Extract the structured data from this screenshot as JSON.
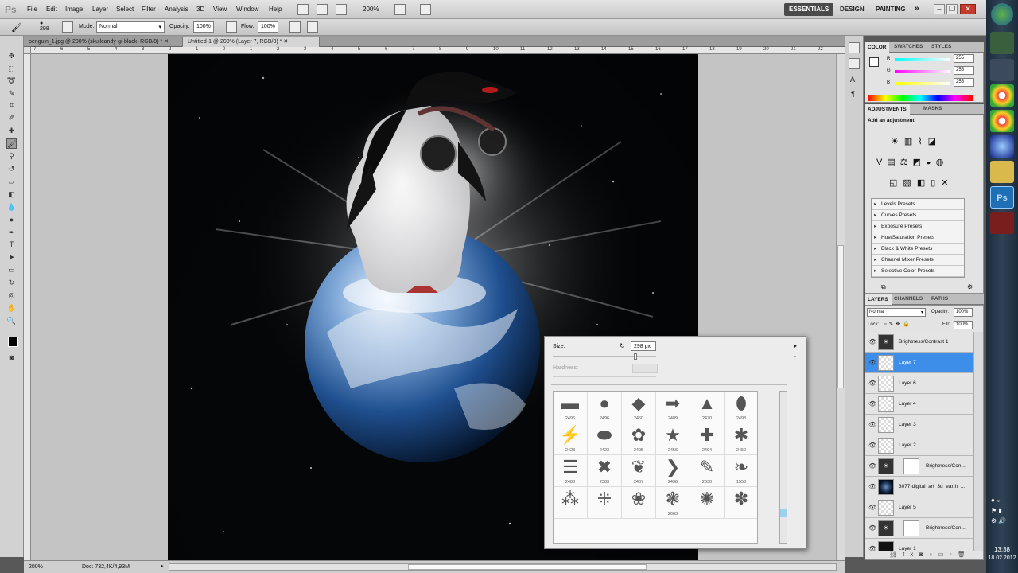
{
  "app": {
    "logo": "Ps"
  },
  "menu": [
    "File",
    "Edit",
    "Image",
    "Layer",
    "Select",
    "Filter",
    "Analysis",
    "3D",
    "View",
    "Window",
    "Help"
  ],
  "menubar_zoom": "200%",
  "workspaces": [
    "ESSENTIALS",
    "DESIGN",
    "PAINTING"
  ],
  "options": {
    "brush_size": "298",
    "mode_label": "Mode:",
    "mode_value": "Normal",
    "opacity_label": "Opacity:",
    "opacity_value": "100%",
    "flow_label": "Flow:",
    "flow_value": "100%"
  },
  "tabs": [
    {
      "label": "penguin_1.jpg @ 200% (skullcandy-gi-black, RGB/8) *"
    },
    {
      "label": "Untitled-1 @ 200% (Layer 7, RGB/8) *"
    }
  ],
  "ruler_ticks": [
    "7",
    "6",
    "5",
    "4",
    "3",
    "2",
    "1",
    "0",
    "1",
    "2",
    "3",
    "4",
    "5",
    "6",
    "7",
    "8",
    "9",
    "10",
    "11",
    "12",
    "13",
    "14",
    "15",
    "16",
    "17",
    "18",
    "19",
    "20",
    "21",
    "22"
  ],
  "status": {
    "zoom": "200%",
    "doc": "Doc: 732,4K/4,93M"
  },
  "color_panel": {
    "tabs": [
      "COLOR",
      "SWATCHES",
      "STYLES"
    ],
    "r_label": "R",
    "g_label": "G",
    "b_label": "B",
    "r": "255",
    "g": "255",
    "b": "255"
  },
  "adjustments": {
    "tabs": [
      "ADJUSTMENTS",
      "MASKS"
    ],
    "title": "Add an adjustment",
    "presets": [
      "Levels Presets",
      "Curves Presets",
      "Exposure Presets",
      "Hue/Saturation Presets",
      "Black & White Presets",
      "Channel Mixer Presets",
      "Selective Color Presets"
    ]
  },
  "layers_panel": {
    "tabs": [
      "LAYERS",
      "CHANNELS",
      "PATHS"
    ],
    "blend": "Normal",
    "opacity_label": "Opacity:",
    "opacity": "100%",
    "lock_label": "Lock:",
    "fill_label": "Fill:",
    "fill": "100%",
    "layers": [
      {
        "name": "Brightness/Contrast 1"
      },
      {
        "name": "Layer 7"
      },
      {
        "name": "Layer 6"
      },
      {
        "name": "Layer 4"
      },
      {
        "name": "Layer 3"
      },
      {
        "name": "Layer 2"
      },
      {
        "name": "Brightness/Con..."
      },
      {
        "name": "3077-digital_art_3d_earth_..."
      },
      {
        "name": "Layer 5"
      },
      {
        "name": "Brightness/Con..."
      },
      {
        "name": "Layer 1"
      }
    ]
  },
  "brush_picker": {
    "size_label": "Size:",
    "size_value": "298 px",
    "hardness_label": "Hardness:",
    "brushes": [
      "2496",
      "2496",
      "2460",
      "2489",
      "2470",
      "2493",
      "2423",
      "2423",
      "2495",
      "2456",
      "2494",
      "2450",
      "2488",
      "2383",
      "2407",
      "2436",
      "2630",
      "1553",
      "",
      "",
      "",
      "2063",
      "",
      ""
    ]
  },
  "clock": {
    "time": "13:38",
    "date": "18.02.2012"
  }
}
